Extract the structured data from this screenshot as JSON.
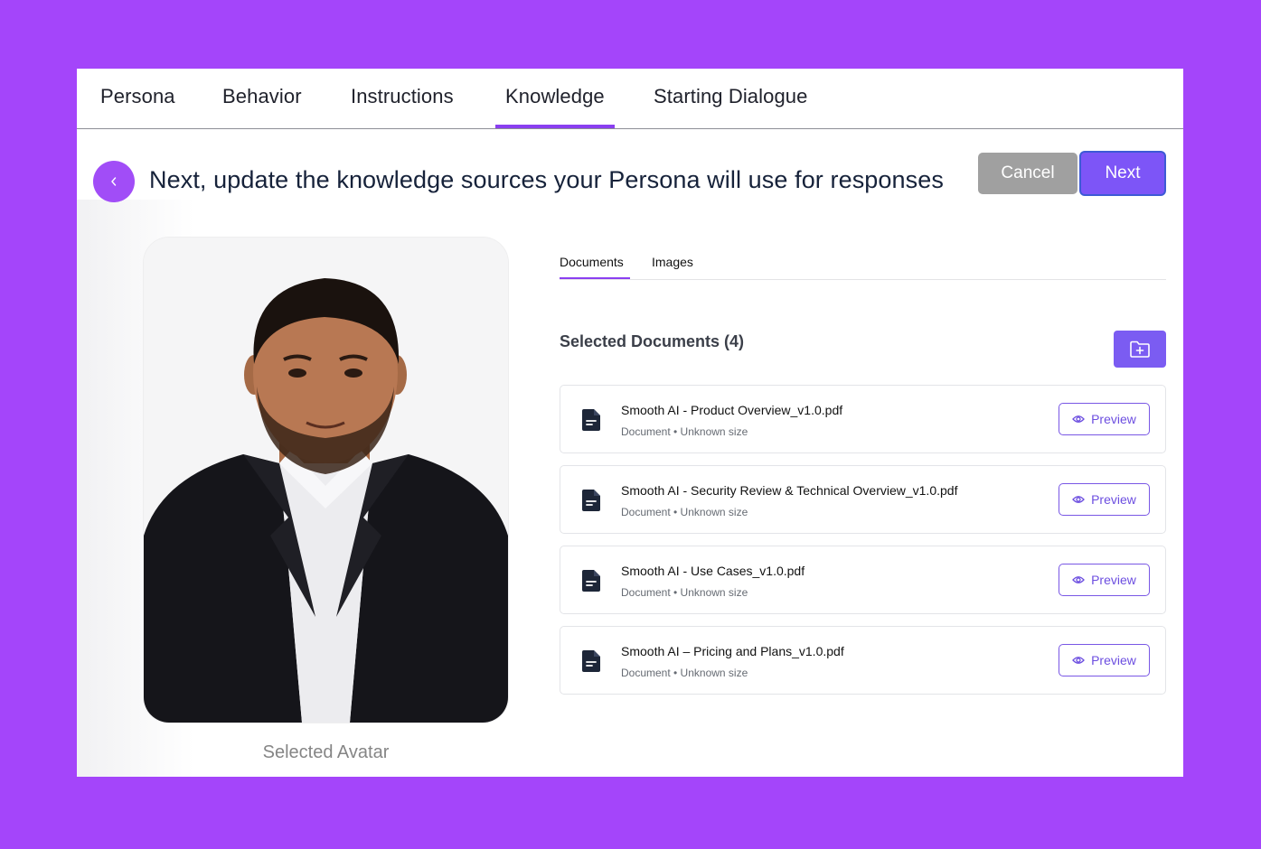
{
  "tabs": [
    {
      "label": "Persona"
    },
    {
      "label": "Behavior"
    },
    {
      "label": "Instructions"
    },
    {
      "label": "Knowledge",
      "active": true
    },
    {
      "label": "Starting Dialogue"
    }
  ],
  "header": {
    "title": "Next, update the knowledge sources your Persona will use for responses",
    "cancel_label": "Cancel",
    "next_label": "Next",
    "back_icon": "chevron-left-icon"
  },
  "avatar": {
    "caption": "Selected Avatar"
  },
  "subtabs": [
    {
      "label": "Documents",
      "active": true
    },
    {
      "label": "Images"
    }
  ],
  "documents": {
    "title": "Selected Documents (4)",
    "add_icon": "folder-plus-icon",
    "items": [
      {
        "name": "Smooth AI - Product Overview_v1.0.pdf",
        "meta": "Document • Unknown size",
        "preview_label": "Preview"
      },
      {
        "name": "Smooth AI - Security Review & Technical Overview_v1.0.pdf",
        "meta": "Document • Unknown size",
        "preview_label": "Preview"
      },
      {
        "name": "Smooth AI - Use Cases_v1.0.pdf",
        "meta": "Document • Unknown size",
        "preview_label": "Preview"
      },
      {
        "name": "Smooth AI – Pricing and Plans_v1.0.pdf",
        "meta": "Document • Unknown size",
        "preview_label": "Preview"
      }
    ]
  },
  "colors": {
    "background": "#a445fa",
    "accent": "#8a3ff0",
    "next_button": "#7d55f7",
    "cancel_button": "#a0a0a0"
  }
}
